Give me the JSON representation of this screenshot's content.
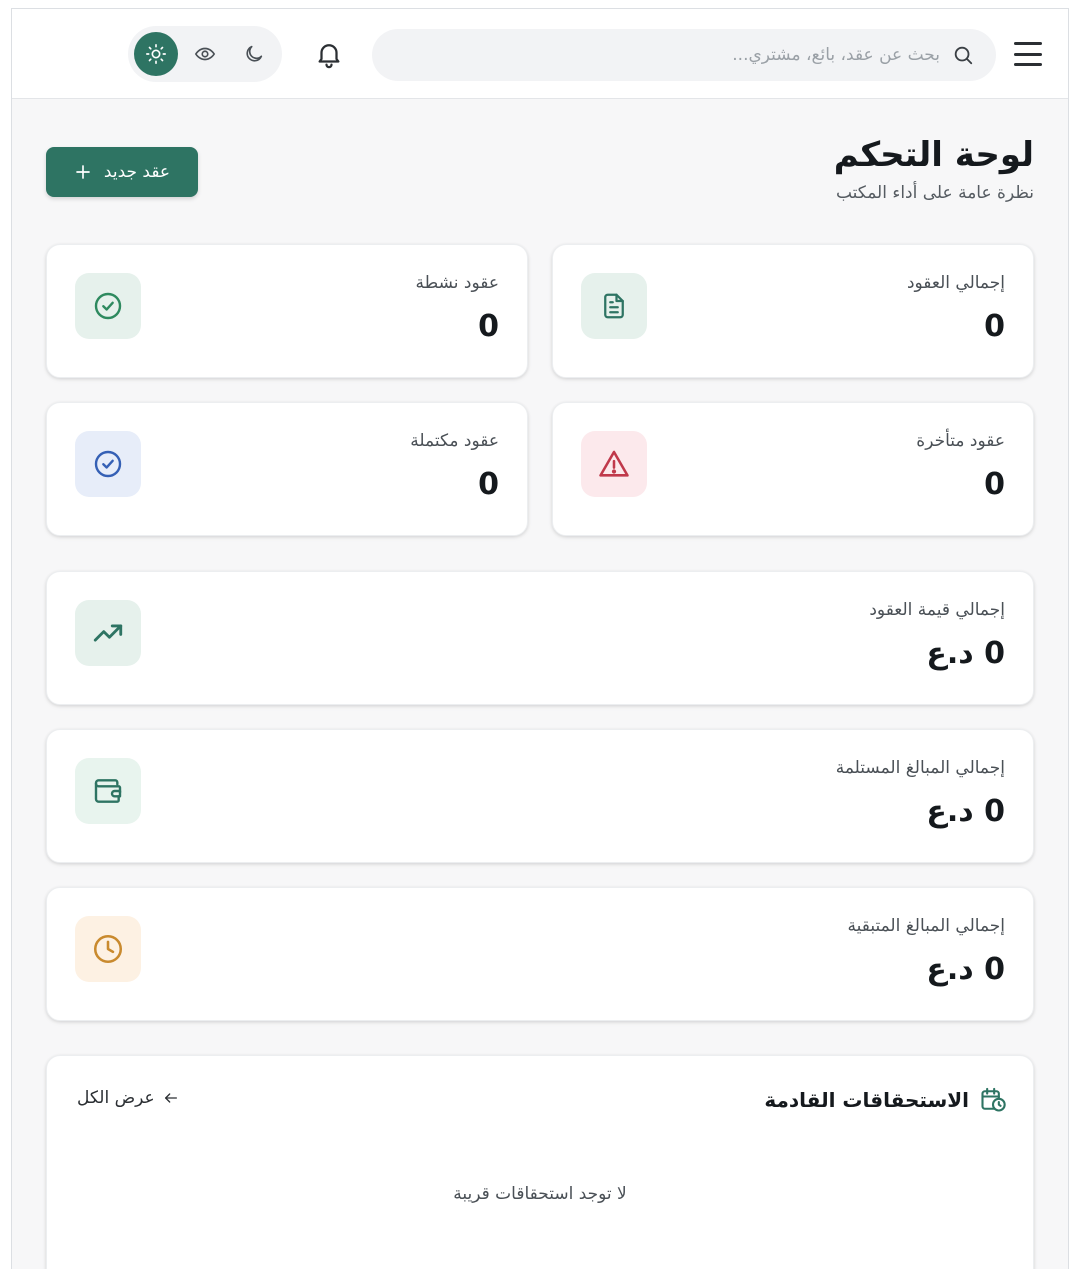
{
  "header": {
    "search_placeholder": "بحث عن عقد، بائع، مشتري...",
    "view_modes": [
      "light",
      "eye",
      "dark"
    ],
    "active_view_mode": "light"
  },
  "page": {
    "title": "لوحة التحكم",
    "subtitle": "نظرة عامة على أداء المكتب",
    "new_contract_label": "عقد جديد"
  },
  "stats": {
    "total_contracts": {
      "label": "إجمالي العقود",
      "value": "0",
      "icon": "document-icon",
      "color": "#2e7463"
    },
    "active_contracts": {
      "label": "عقود نشطة",
      "value": "0",
      "icon": "check-circle-icon",
      "color": "#2e8a5f"
    },
    "overdue_contracts": {
      "label": "عقود متأخرة",
      "value": "0",
      "icon": "warning-icon",
      "color": "#c0394b"
    },
    "completed_contracts": {
      "label": "عقود مكتملة",
      "value": "0",
      "icon": "check-circle-icon",
      "color": "#3560b5"
    }
  },
  "totals": {
    "contracts_value": {
      "label": "إجمالي قيمة العقود",
      "value": "0 د.ع",
      "icon": "trending-up-icon",
      "color": "#2e7463"
    },
    "received": {
      "label": "إجمالي المبالغ المستلمة",
      "value": "0 د.ع",
      "icon": "wallet-icon",
      "color": "#2e7463"
    },
    "remaining": {
      "label": "إجمالي المبالغ المتبقية",
      "value": "0 د.ع",
      "icon": "clock-icon",
      "color": "#c98a2e"
    }
  },
  "upcoming": {
    "title": "الاستحقاقات القادمة",
    "view_all_label": "عرض الكل",
    "empty_message": "لا توجد استحقاقات قريبة"
  },
  "colors": {
    "primary": "#2e7463",
    "background": "#f7f7f8"
  }
}
